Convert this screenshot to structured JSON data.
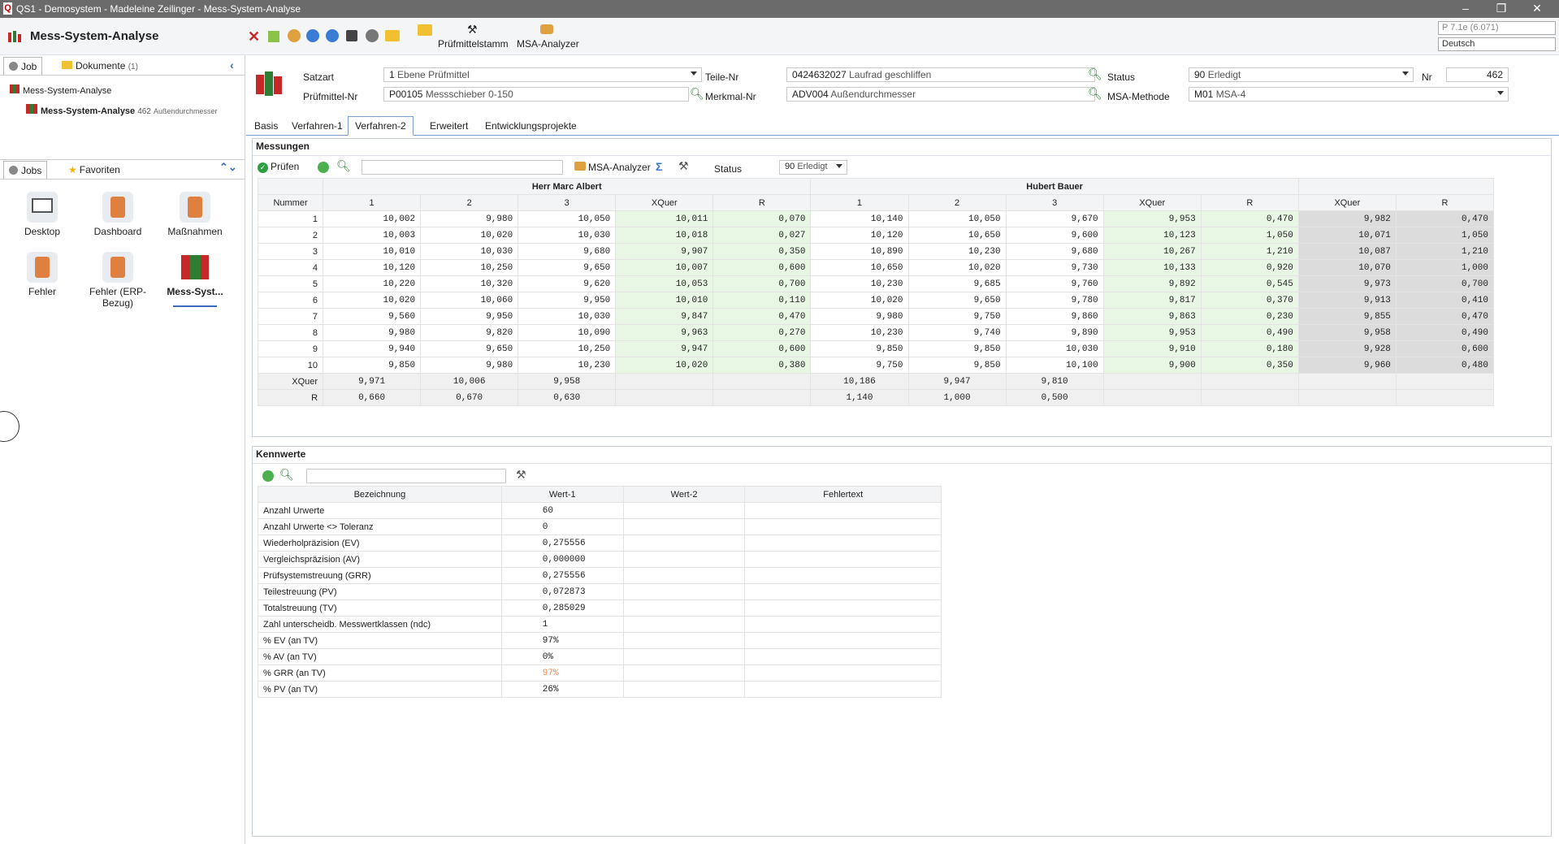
{
  "window": {
    "title": "QS1 - Demosystem - Madeleine Zeilinger - Mess-System-Analyse",
    "minimize": "–",
    "restore": "❐",
    "close": "✕"
  },
  "app": {
    "title": "Mess-System-Analyse",
    "toolbar": {
      "pruefmittelstamm": "Prüfmittelstamm",
      "msa_analyzer": "MSA-Analyzer"
    },
    "version": "P 7.1e (6.071)",
    "language": "Deutsch"
  },
  "left": {
    "tab_job": "Job",
    "tab_dokumente": "Dokumente",
    "dok_count": "(1)",
    "tree_root": "Mess-System-Analyse",
    "tree_child": "Mess-System-Analyse",
    "tree_child_num": "462",
    "tree_child_desc": "Außendurchmesser",
    "tab_jobs": "Jobs",
    "tab_favoriten": "Favoriten",
    "jobs": [
      {
        "label": "Desktop"
      },
      {
        "label": "Dashboard"
      },
      {
        "label": "Maßnahmen"
      },
      {
        "label": "Fehler"
      },
      {
        "label": "Fehler (ERP-Bezug)"
      },
      {
        "label": "Mess-Syst..."
      }
    ]
  },
  "header": {
    "satzart_label": "Satzart",
    "satzart_num": "1",
    "satzart_text": "Ebene Prüfmittel",
    "pm_label": "Prüfmittel-Nr",
    "pm_num": "P00105",
    "pm_text": "Messschieber 0-150",
    "teile_label": "Teile-Nr",
    "teile_num": "0424632027",
    "teile_text": "Laufrad geschliffen",
    "merkmal_label": "Merkmal-Nr",
    "merkmal_num": "ADV004",
    "merkmal_text": "Außendurchmesser",
    "status_label": "Status",
    "status_num": "90",
    "status_text": "Erledigt",
    "msa_label": "MSA-Methode",
    "msa_num": "M01",
    "msa_text": "MSA-4",
    "nr_label": "Nr",
    "nr_value": "462"
  },
  "tabs": [
    "Basis",
    "Verfahren-1",
    "Verfahren-2",
    "Erweitert",
    "Entwicklungsprojekte"
  ],
  "messungen": {
    "title": "Messungen",
    "pruefen": "Prüfen",
    "msa_analyzer": "MSA-Analyzer",
    "status_label": "Status",
    "status_num": "90",
    "status_text": "Erledigt",
    "op1": "Herr Marc Albert",
    "op2": "Hubert Bauer",
    "cols": [
      "Nummer",
      "1",
      "2",
      "3",
      "XQuer",
      "R",
      "1",
      "2",
      "3",
      "XQuer",
      "R",
      "XQuer",
      "R"
    ],
    "rows": [
      [
        "1",
        "10,002",
        "9,980",
        "10,050",
        "10,011",
        "0,070",
        "10,140",
        "10,050",
        "9,670",
        "9,953",
        "0,470",
        "9,982",
        "0,470"
      ],
      [
        "2",
        "10,003",
        "10,020",
        "10,030",
        "10,018",
        "0,027",
        "10,120",
        "10,650",
        "9,600",
        "10,123",
        "1,050",
        "10,071",
        "1,050"
      ],
      [
        "3",
        "10,010",
        "10,030",
        "9,680",
        "9,907",
        "0,350",
        "10,890",
        "10,230",
        "9,680",
        "10,267",
        "1,210",
        "10,087",
        "1,210"
      ],
      [
        "4",
        "10,120",
        "10,250",
        "9,650",
        "10,007",
        "0,600",
        "10,650",
        "10,020",
        "9,730",
        "10,133",
        "0,920",
        "10,070",
        "1,000"
      ],
      [
        "5",
        "10,220",
        "10,320",
        "9,620",
        "10,053",
        "0,700",
        "10,230",
        "9,685",
        "9,760",
        "9,892",
        "0,545",
        "9,973",
        "0,700"
      ],
      [
        "6",
        "10,020",
        "10,060",
        "9,950",
        "10,010",
        "0,110",
        "10,020",
        "9,650",
        "9,780",
        "9,817",
        "0,370",
        "9,913",
        "0,410"
      ],
      [
        "7",
        "9,560",
        "9,950",
        "10,030",
        "9,847",
        "0,470",
        "9,980",
        "9,750",
        "9,860",
        "9,863",
        "0,230",
        "9,855",
        "0,470"
      ],
      [
        "8",
        "9,980",
        "9,820",
        "10,090",
        "9,963",
        "0,270",
        "10,230",
        "9,740",
        "9,890",
        "9,953",
        "0,490",
        "9,958",
        "0,490"
      ],
      [
        "9",
        "9,940",
        "9,650",
        "10,250",
        "9,947",
        "0,600",
        "9,850",
        "9,850",
        "10,030",
        "9,910",
        "0,180",
        "9,928",
        "0,600"
      ],
      [
        "10",
        "9,850",
        "9,980",
        "10,230",
        "10,020",
        "0,380",
        "9,750",
        "9,850",
        "10,100",
        "9,900",
        "0,350",
        "9,960",
        "0,480"
      ]
    ],
    "foot": [
      [
        "XQuer",
        "9,971",
        "10,006",
        "9,958",
        "",
        "",
        "10,186",
        "9,947",
        "9,810",
        "",
        "",
        "",
        ""
      ],
      [
        "R",
        "0,660",
        "0,670",
        "0,630",
        "",
        "",
        "1,140",
        "1,000",
        "0,500",
        "",
        "",
        "",
        ""
      ]
    ]
  },
  "kennwerte": {
    "title": "Kennwerte",
    "cols": [
      "Bezeichnung",
      "Wert-1",
      "Wert-2",
      "Fehlertext"
    ],
    "rows": [
      [
        "Anzahl Urwerte",
        "60"
      ],
      [
        "Anzahl Urwerte <> Toleranz",
        "0"
      ],
      [
        "Wiederholpräzision (EV)",
        "0,275556"
      ],
      [
        "Vergleichspräzision (AV)",
        "0,000000"
      ],
      [
        "Prüfsystemstreuung (GRR)",
        "0,275556"
      ],
      [
        "Teilestreuung (PV)",
        "0,072873"
      ],
      [
        "Totalstreuung (TV)",
        "0,285029"
      ],
      [
        "Zahl unterscheidb. Messwertklassen (ndc)",
        "1"
      ],
      [
        "% EV (an TV)",
        "97%"
      ],
      [
        "% AV (an TV)",
        "0%"
      ],
      [
        "% GRR (an TV)",
        "97%"
      ],
      [
        "% PV (an TV)",
        "26%"
      ]
    ],
    "highlight_color": "#f08a4b"
  },
  "colors": {
    "accent": "#3a7bd5",
    "green_cell": "#e8f7e4",
    "gray_cell": "#dcdcdc"
  }
}
